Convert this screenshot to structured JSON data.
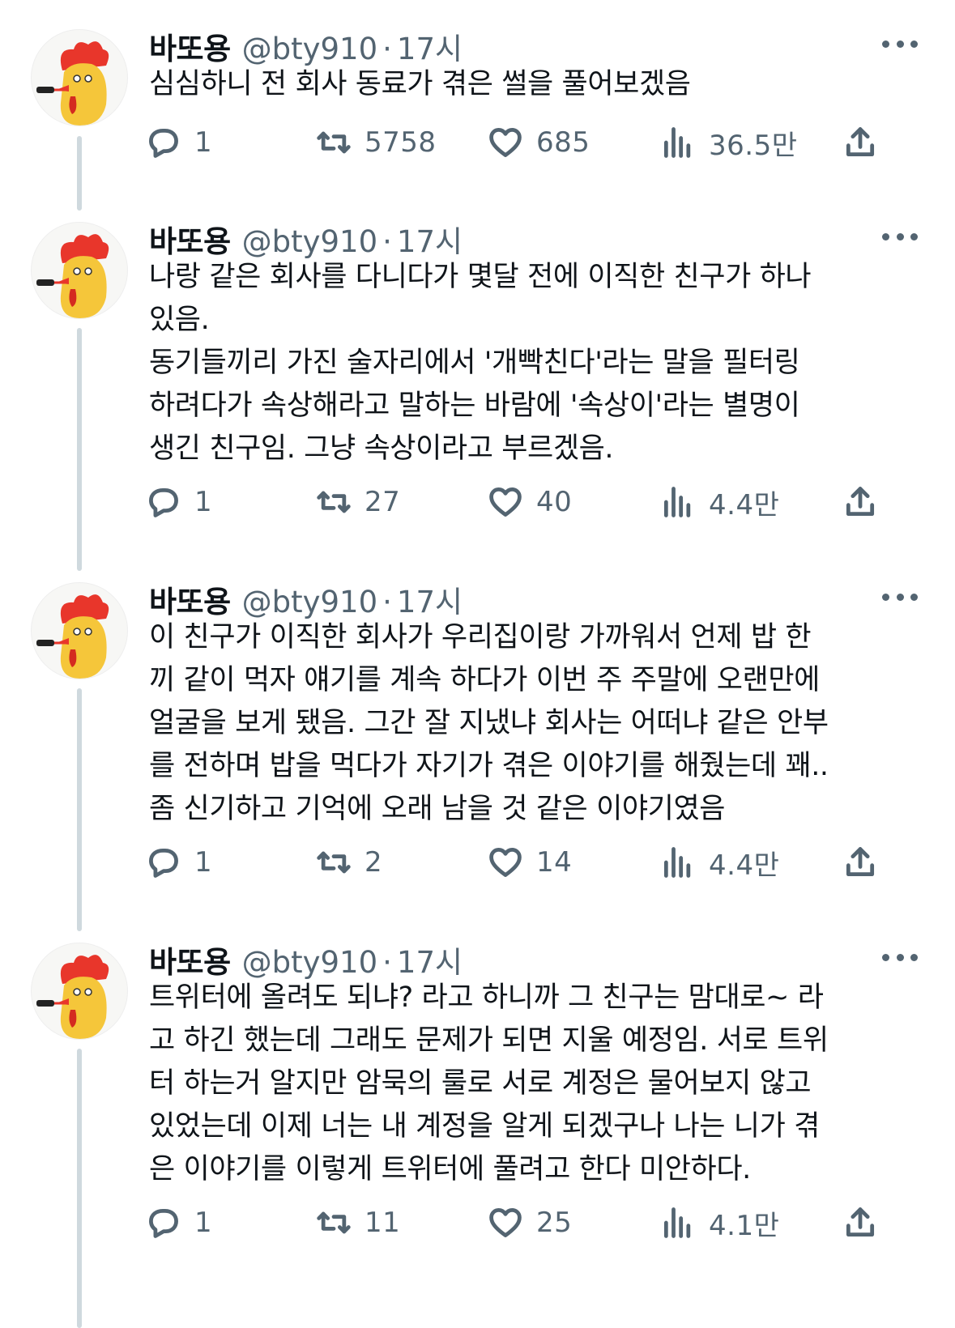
{
  "colors": {
    "text": "#0f1419",
    "secondary": "#536471",
    "thread_line": "#cfd9de",
    "avatar_comb": "#e8362b",
    "avatar_body": "#f5c63a"
  },
  "icons": {
    "reply": "reply-icon",
    "retweet": "retweet-icon",
    "like": "heart-icon",
    "views": "views-icon",
    "share": "share-icon",
    "more": "more-icon"
  },
  "tweets": [
    {
      "name": "바또용",
      "handle": "@bty910",
      "dot": "·",
      "time": "17시",
      "text": [
        "심심하니 전 회사 동료가 겪은 썰을 풀어보겠음"
      ],
      "replies": "1",
      "retweets": "5758",
      "likes": "685",
      "views": "36.5만"
    },
    {
      "name": "바또용",
      "handle": "@bty910",
      "dot": "·",
      "time": "17시",
      "text": [
        "나랑 같은 회사를 다니다가 몇달 전에 이직한 친구가 하나",
        "있음.",
        "동기들끼리 가진 술자리에서 '개빡친다'라는 말을 필터링",
        "하려다가 속상해라고 말하는 바람에 '속상이'라는 별명이",
        "생긴 친구임. 그냥 속상이라고 부르겠음."
      ],
      "replies": "1",
      "retweets": "27",
      "likes": "40",
      "views": "4.4만"
    },
    {
      "name": "바또용",
      "handle": "@bty910",
      "dot": "·",
      "time": "17시",
      "text": [
        "이 친구가 이직한 회사가 우리집이랑 가까워서 언제 밥 한",
        "끼 같이 먹자 얘기를 계속 하다가 이번 주 주말에 오랜만에",
        "얼굴을 보게 됐음. 그간 잘 지냈냐 회사는 어떠냐 같은 안부",
        "를 전하며 밥을 먹다가 자기가 겪은 이야기를 해줬는데 꽤..",
        "좀 신기하고 기억에 오래 남을 것 같은 이야기였음"
      ],
      "replies": "1",
      "retweets": "2",
      "likes": "14",
      "views": "4.4만"
    },
    {
      "name": "바또용",
      "handle": "@bty910",
      "dot": "·",
      "time": "17시",
      "text": [
        "트위터에 올려도 되냐? 라고 하니까 그 친구는 맘대로~ 라",
        "고 하긴 했는데 그래도 문제가 되면 지울 예정임. 서로 트위",
        "터 하는거 알지만 암묵의 룰로 서로 계정은 물어보지 않고",
        "있었는데 이제 너는 내 계정을 알게 되겠구나 나는 니가 겪",
        "은 이야기를 이렇게 트위터에 풀려고 한다 미안하다."
      ],
      "replies": "1",
      "retweets": "11",
      "likes": "25",
      "views": "4.1만"
    }
  ]
}
